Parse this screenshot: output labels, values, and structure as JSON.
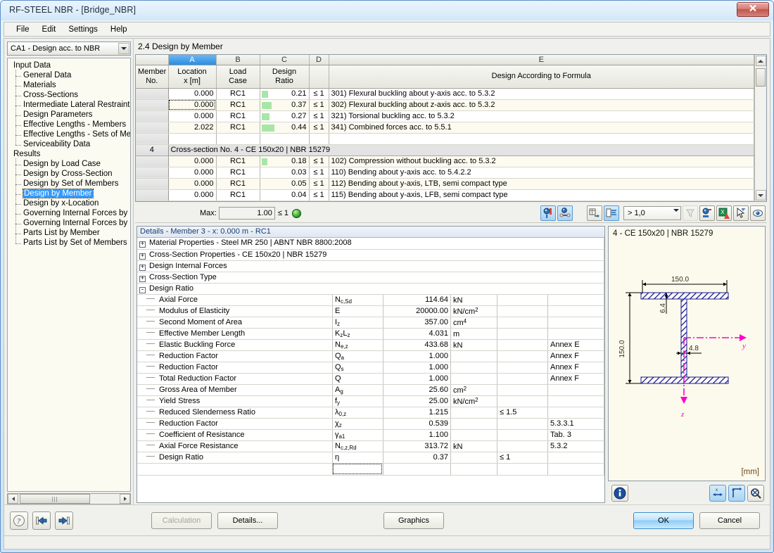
{
  "window": {
    "title": "RF-STEEL NBR - [Bridge_NBR]",
    "close_label": "✕"
  },
  "menu": {
    "items": [
      {
        "label": "File"
      },
      {
        "label": "Edit"
      },
      {
        "label": "Settings"
      },
      {
        "label": "Help"
      }
    ]
  },
  "sidebar": {
    "combo_value": "CA1 - Design acc. to NBR",
    "tree": [
      {
        "label": "Input Data",
        "type": "root"
      },
      {
        "label": "General Data",
        "type": "child"
      },
      {
        "label": "Materials",
        "type": "child"
      },
      {
        "label": "Cross-Sections",
        "type": "child"
      },
      {
        "label": "Intermediate Lateral Restraints",
        "type": "child"
      },
      {
        "label": "Design Parameters",
        "type": "child"
      },
      {
        "label": "Effective Lengths - Members",
        "type": "child"
      },
      {
        "label": "Effective Lengths - Sets of Mem",
        "type": "child"
      },
      {
        "label": "Serviceability Data",
        "type": "child",
        "last": true
      },
      {
        "label": "Results",
        "type": "root"
      },
      {
        "label": "Design by Load Case",
        "type": "child"
      },
      {
        "label": "Design by Cross-Section",
        "type": "child"
      },
      {
        "label": "Design by Set of Members",
        "type": "child"
      },
      {
        "label": "Design by Member",
        "type": "child",
        "selected": true
      },
      {
        "label": "Design by x-Location",
        "type": "child"
      },
      {
        "label": "Governing Internal Forces by M",
        "type": "child"
      },
      {
        "label": "Governing Internal Forces by S",
        "type": "child"
      },
      {
        "label": "Parts List by Member",
        "type": "child"
      },
      {
        "label": "Parts List by Set of Members",
        "type": "child",
        "last": true
      }
    ]
  },
  "main": {
    "page_title": "2.4 Design by Member",
    "table": {
      "column_letters": [
        "",
        "A",
        "B",
        "C",
        "D",
        "E"
      ],
      "headers": {
        "member_no": "Member\nNo.",
        "member_no_l1": "Member",
        "member_no_l2": "No.",
        "location_l1": "Location",
        "location_l2": "x [m]",
        "loadcase_l1": "Load",
        "loadcase_l2": "Case",
        "ratio_l1": "Design",
        "ratio_l2": "Ratio",
        "limit": "",
        "formula": "Design According to Formula"
      },
      "rows": [
        {
          "member": "",
          "location": "0.000",
          "loadcase": "RC1",
          "ratio": "0.21",
          "bar_pct": 21,
          "limit": "≤ 1",
          "formula": "301) Flexural buckling about y-axis acc. to 5.3.2",
          "alt": false
        },
        {
          "member": "",
          "location": "0.000",
          "loadcase": "RC1",
          "ratio": "0.37",
          "bar_pct": 37,
          "limit": "≤ 1",
          "formula": "302) Flexural buckling about z-axis acc. to 5.3.2",
          "alt": true,
          "selected": true
        },
        {
          "member": "",
          "location": "0.000",
          "loadcase": "RC1",
          "ratio": "0.27",
          "bar_pct": 27,
          "limit": "≤ 1",
          "formula": "321) Torsional buckling acc. to 5.3.2",
          "alt": false
        },
        {
          "member": "",
          "location": "2.022",
          "loadcase": "RC1",
          "ratio": "0.44",
          "bar_pct": 44,
          "limit": "≤ 1",
          "formula": "341) Combined forces acc. to 5.5.1",
          "alt": true
        },
        {
          "member": "",
          "location": "",
          "loadcase": "",
          "ratio": "",
          "bar_pct": 0,
          "limit": "",
          "formula": "",
          "alt": false,
          "blank": true
        },
        {
          "member": "4",
          "group_label": "Cross-section No.  4 - CE 150x20 | NBR 15279",
          "group": true
        },
        {
          "member": "",
          "location": "0.000",
          "loadcase": "RC1",
          "ratio": "0.18",
          "bar_pct": 18,
          "limit": "≤ 1",
          "formula": "102) Compression without buckling acc. to 5.3.2",
          "alt": true
        },
        {
          "member": "",
          "location": "0.000",
          "loadcase": "RC1",
          "ratio": "0.03",
          "bar_pct": 0,
          "limit": "≤ 1",
          "formula": "110) Bending about y-axis acc. to 5.4.2.2",
          "alt": false
        },
        {
          "member": "",
          "location": "0.000",
          "loadcase": "RC1",
          "ratio": "0.05",
          "bar_pct": 0,
          "limit": "≤ 1",
          "formula": "112) Bending about y-axis, LTB, semi compact type",
          "alt": true
        },
        {
          "member": "",
          "location": "0.000",
          "loadcase": "RC1",
          "ratio": "0.04",
          "bar_pct": 0,
          "limit": "≤ 1",
          "formula": "115) Bending about y-axis, LFB, semi compact type",
          "alt": false
        }
      ]
    },
    "toolbar": {
      "max_label": "Max:",
      "max_value": "1.00",
      "max_limit": "≤ 1",
      "filter_value": "> 1,0"
    }
  },
  "details": {
    "header": "Details - Member 3 - x: 0.000 m - RC1",
    "sections": [
      {
        "expander": "+",
        "label": "Material Properties - Steel MR 250 | ABNT NBR 8800:2008"
      },
      {
        "expander": "+",
        "label": "Cross-Section Properties  -  CE 150x20 | NBR 15279"
      },
      {
        "expander": "+",
        "label": "Design Internal Forces"
      },
      {
        "expander": "+",
        "label": "Cross-Section Type"
      },
      {
        "expander": "-",
        "label": "Design Ratio"
      }
    ],
    "rows": [
      {
        "name": "Axial Force",
        "sym_base": "N",
        "sym_sub": "c,Sd",
        "value": "114.64",
        "unit": "kN",
        "unit_sup": "",
        "limit": "",
        "ref": ""
      },
      {
        "name": "Modulus of Elasticity",
        "sym_base": "E",
        "sym_sub": "",
        "value": "20000.00",
        "unit": "kN/cm",
        "unit_sup": "2",
        "limit": "",
        "ref": ""
      },
      {
        "name": "Second Moment of Area",
        "sym_base": "I",
        "sym_sub": "z",
        "value": "357.00",
        "unit": "cm",
        "unit_sup": "4",
        "limit": "",
        "ref": ""
      },
      {
        "name": "Effective Member Length",
        "sym_base": "K",
        "sym_sub": "z",
        "sym_base2": "L",
        "sym_sub2": "z",
        "value": "4.031",
        "unit": "m",
        "unit_sup": "",
        "limit": "",
        "ref": ""
      },
      {
        "name": "Elastic Buckling Force",
        "sym_base": "N",
        "sym_sub": "e,z",
        "value": "433.68",
        "unit": "kN",
        "unit_sup": "",
        "limit": "",
        "ref": "Annex E"
      },
      {
        "name": "Reduction Factor",
        "sym_base": "Q",
        "sym_sub": "a",
        "value": "1.000",
        "unit": "",
        "unit_sup": "",
        "limit": "",
        "ref": "Annex F"
      },
      {
        "name": "Reduction Factor",
        "sym_base": "Q",
        "sym_sub": "s",
        "value": "1.000",
        "unit": "",
        "unit_sup": "",
        "limit": "",
        "ref": "Annex F"
      },
      {
        "name": "Total Reduction Factor",
        "sym_base": "Q",
        "sym_sub": "",
        "value": "1.000",
        "unit": "",
        "unit_sup": "",
        "limit": "",
        "ref": "Annex F"
      },
      {
        "name": "Gross Area of Member",
        "sym_base": "A",
        "sym_sub": "g",
        "value": "25.60",
        "unit": "cm",
        "unit_sup": "2",
        "limit": "",
        "ref": ""
      },
      {
        "name": "Yield Stress",
        "sym_base": "f",
        "sym_sub": "y",
        "value": "25.00",
        "unit": "kN/cm",
        "unit_sup": "2",
        "limit": "",
        "ref": ""
      },
      {
        "name": "Reduced Slenderness Ratio",
        "sym_base": "λ",
        "sym_sub": "0,z",
        "value": "1.215",
        "unit": "",
        "unit_sup": "",
        "limit": "≤ 1.5",
        "ref": ""
      },
      {
        "name": "Reduction Factor",
        "sym_base": "χ",
        "sym_sub": "z",
        "value": "0.539",
        "unit": "",
        "unit_sup": "",
        "limit": "",
        "ref": "5.3.3.1"
      },
      {
        "name": "Coefficient of Resistance",
        "sym_base": "γ",
        "sym_sub": "a1",
        "value": "1.100",
        "unit": "",
        "unit_sup": "",
        "limit": "",
        "ref": "Tab. 3"
      },
      {
        "name": "Axial Force Resistance",
        "sym_base": "N",
        "sym_sub": "c,z,Rd",
        "value": "313.72",
        "unit": "kN",
        "unit_sup": "",
        "limit": "",
        "ref": "5.3.2"
      },
      {
        "name": "Design Ratio",
        "sym_base": "η",
        "sym_sub": "",
        "value": "0.37",
        "unit": "",
        "unit_sup": "",
        "limit": "≤ 1",
        "ref": ""
      }
    ]
  },
  "graphic": {
    "title": "4 - CE 150x20 | NBR 15279",
    "unit": "[mm]",
    "dim_width": "150.0",
    "dim_height": "150.0",
    "dim_flange": "6.4",
    "dim_web": "4.8",
    "axis_y": "y",
    "axis_z": "z"
  },
  "buttons": {
    "calculation": "Calculation",
    "details": "Details...",
    "graphics": "Graphics",
    "ok": "OK",
    "cancel": "Cancel"
  },
  "colors": {
    "accent": "#3399ff",
    "ratio_bar": "#a8e6a8",
    "section_line": "#1a1a8c",
    "axis": "#ff00cc",
    "title_text": "#1b3c6e"
  }
}
